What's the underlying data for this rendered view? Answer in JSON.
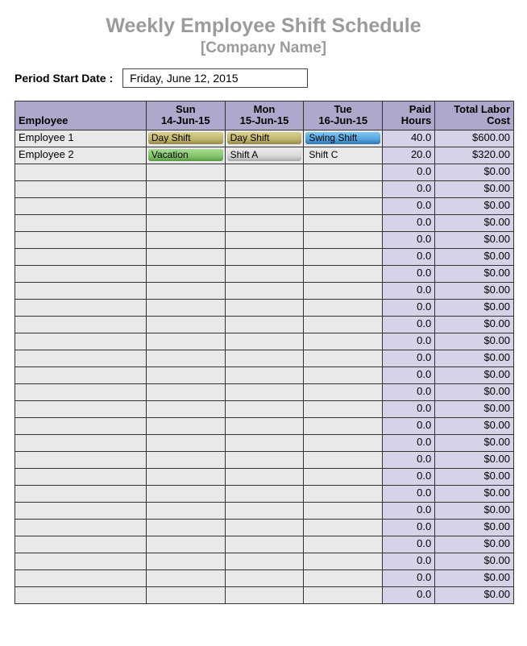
{
  "header": {
    "title": "Weekly Employee Shift Schedule",
    "subtitle": "[Company Name]"
  },
  "period": {
    "label": "Period Start Date :",
    "value": "Friday, June 12, 2015"
  },
  "columns": {
    "employee": "Employee",
    "days": [
      {
        "dow": "Sun",
        "date": "14-Jun-15"
      },
      {
        "dow": "Mon",
        "date": "15-Jun-15"
      },
      {
        "dow": "Tue",
        "date": "16-Jun-15"
      }
    ],
    "paid": "Paid Hours",
    "cost": "Total Labor Cost"
  },
  "shiftStyles": {
    "Day Shift": "pill-day",
    "Swing Shift": "pill-swing",
    "Vacation": "pill-vacation",
    "Shift A": "pill-shifta",
    "Shift C": "pill-shiftc"
  },
  "rows": [
    {
      "employee": "Employee 1",
      "d0": "Day Shift",
      "d1": "Day Shift",
      "d2": "Swing Shift",
      "paid": "40.0",
      "cost": "$600.00"
    },
    {
      "employee": "Employee 2",
      "d0": "Vacation",
      "d1": "Shift A",
      "d2": "Shift C",
      "paid": "20.0",
      "cost": "$320.00"
    },
    {
      "employee": "",
      "d0": "",
      "d1": "",
      "d2": "",
      "paid": "0.0",
      "cost": "$0.00"
    },
    {
      "employee": "",
      "d0": "",
      "d1": "",
      "d2": "",
      "paid": "0.0",
      "cost": "$0.00"
    },
    {
      "employee": "",
      "d0": "",
      "d1": "",
      "d2": "",
      "paid": "0.0",
      "cost": "$0.00"
    },
    {
      "employee": "",
      "d0": "",
      "d1": "",
      "d2": "",
      "paid": "0.0",
      "cost": "$0.00"
    },
    {
      "employee": "",
      "d0": "",
      "d1": "",
      "d2": "",
      "paid": "0.0",
      "cost": "$0.00"
    },
    {
      "employee": "",
      "d0": "",
      "d1": "",
      "d2": "",
      "paid": "0.0",
      "cost": "$0.00"
    },
    {
      "employee": "",
      "d0": "",
      "d1": "",
      "d2": "",
      "paid": "0.0",
      "cost": "$0.00"
    },
    {
      "employee": "",
      "d0": "",
      "d1": "",
      "d2": "",
      "paid": "0.0",
      "cost": "$0.00"
    },
    {
      "employee": "",
      "d0": "",
      "d1": "",
      "d2": "",
      "paid": "0.0",
      "cost": "$0.00"
    },
    {
      "employee": "",
      "d0": "",
      "d1": "",
      "d2": "",
      "paid": "0.0",
      "cost": "$0.00"
    },
    {
      "employee": "",
      "d0": "",
      "d1": "",
      "d2": "",
      "paid": "0.0",
      "cost": "$0.00"
    },
    {
      "employee": "",
      "d0": "",
      "d1": "",
      "d2": "",
      "paid": "0.0",
      "cost": "$0.00"
    },
    {
      "employee": "",
      "d0": "",
      "d1": "",
      "d2": "",
      "paid": "0.0",
      "cost": "$0.00"
    },
    {
      "employee": "",
      "d0": "",
      "d1": "",
      "d2": "",
      "paid": "0.0",
      "cost": "$0.00"
    },
    {
      "employee": "",
      "d0": "",
      "d1": "",
      "d2": "",
      "paid": "0.0",
      "cost": "$0.00"
    },
    {
      "employee": "",
      "d0": "",
      "d1": "",
      "d2": "",
      "paid": "0.0",
      "cost": "$0.00"
    },
    {
      "employee": "",
      "d0": "",
      "d1": "",
      "d2": "",
      "paid": "0.0",
      "cost": "$0.00"
    },
    {
      "employee": "",
      "d0": "",
      "d1": "",
      "d2": "",
      "paid": "0.0",
      "cost": "$0.00"
    },
    {
      "employee": "",
      "d0": "",
      "d1": "",
      "d2": "",
      "paid": "0.0",
      "cost": "$0.00"
    },
    {
      "employee": "",
      "d0": "",
      "d1": "",
      "d2": "",
      "paid": "0.0",
      "cost": "$0.00"
    },
    {
      "employee": "",
      "d0": "",
      "d1": "",
      "d2": "",
      "paid": "0.0",
      "cost": "$0.00"
    },
    {
      "employee": "",
      "d0": "",
      "d1": "",
      "d2": "",
      "paid": "0.0",
      "cost": "$0.00"
    },
    {
      "employee": "",
      "d0": "",
      "d1": "",
      "d2": "",
      "paid": "0.0",
      "cost": "$0.00"
    },
    {
      "employee": "",
      "d0": "",
      "d1": "",
      "d2": "",
      "paid": "0.0",
      "cost": "$0.00"
    },
    {
      "employee": "",
      "d0": "",
      "d1": "",
      "d2": "",
      "paid": "0.0",
      "cost": "$0.00"
    },
    {
      "employee": "",
      "d0": "",
      "d1": "",
      "d2": "",
      "paid": "0.0",
      "cost": "$0.00"
    }
  ]
}
